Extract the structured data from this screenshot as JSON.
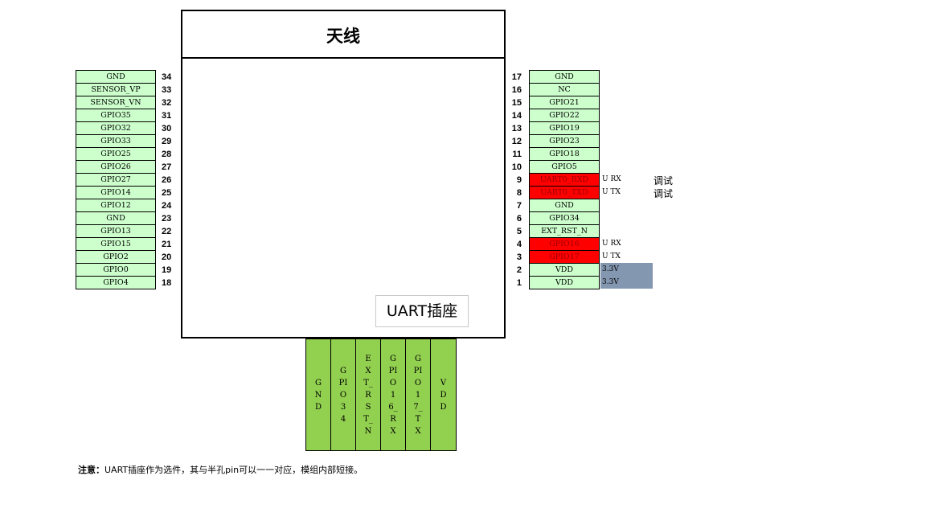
{
  "module": {
    "antenna_label": "天线",
    "uart_label": "UART插座"
  },
  "left_pins": [
    {
      "num": "34",
      "name": "GND"
    },
    {
      "num": "33",
      "name": "SENSOR_VP"
    },
    {
      "num": "32",
      "name": "SENSOR_VN"
    },
    {
      "num": "31",
      "name": "GPIO35"
    },
    {
      "num": "30",
      "name": "GPIO32"
    },
    {
      "num": "29",
      "name": "GPIO33"
    },
    {
      "num": "28",
      "name": "GPIO25"
    },
    {
      "num": "27",
      "name": "GPIO26"
    },
    {
      "num": "26",
      "name": "GPIO27"
    },
    {
      "num": "25",
      "name": "GPIO14"
    },
    {
      "num": "24",
      "name": "GPIO12"
    },
    {
      "num": "23",
      "name": "GND"
    },
    {
      "num": "22",
      "name": "GPIO13"
    },
    {
      "num": "21",
      "name": "GPIO15"
    },
    {
      "num": "20",
      "name": "GPIO2"
    },
    {
      "num": "19",
      "name": "GPIO0"
    },
    {
      "num": "18",
      "name": "GPIO4"
    }
  ],
  "right_pins": [
    {
      "num": "17",
      "name": "GND",
      "note": "",
      "highlight": false
    },
    {
      "num": "16",
      "name": "NC",
      "note": "",
      "highlight": false
    },
    {
      "num": "15",
      "name": "GPIO21",
      "note": "",
      "highlight": false
    },
    {
      "num": "14",
      "name": "GPIO22",
      "note": "",
      "highlight": false
    },
    {
      "num": "13",
      "name": "GPIO19",
      "note": "",
      "highlight": false
    },
    {
      "num": "12",
      "name": "GPIO23",
      "note": "",
      "highlight": false
    },
    {
      "num": "11",
      "name": "GPIO18",
      "note": "",
      "highlight": false
    },
    {
      "num": "10",
      "name": "GPIO5",
      "note": "",
      "highlight": false
    },
    {
      "num": "9",
      "name": "UART0_RXD",
      "note": "U RX",
      "highlight": true
    },
    {
      "num": "8",
      "name": "UART0_TXD",
      "note": "U TX",
      "highlight": true
    },
    {
      "num": "7",
      "name": "GND",
      "note": "",
      "highlight": false
    },
    {
      "num": "6",
      "name": "GPIO34",
      "note": "",
      "highlight": false
    },
    {
      "num": "5",
      "name": "EXT_RST_N",
      "note": "",
      "highlight": false
    },
    {
      "num": "4",
      "name": "GPIO16",
      "note": "U RX",
      "highlight": true
    },
    {
      "num": "3",
      "name": "GPIO17",
      "note": "U TX",
      "highlight": true
    },
    {
      "num": "2",
      "name": "VDD",
      "note": "3.3V",
      "highlight": false
    },
    {
      "num": "1",
      "name": "VDD",
      "note": "3.3V",
      "highlight": false
    }
  ],
  "debug_labels": [
    "调试",
    "调试"
  ],
  "uart_connector": [
    "GND",
    "GPIO34",
    "EXT_RST_N",
    "GPIO16_RX",
    "GPIO17_TX",
    "VDD"
  ],
  "footnote": {
    "label": "注意：",
    "text": "UART插座作为选件，其与半孔pin可以一一对应，模组内部短接。"
  },
  "colors": {
    "pin_fill": "#ccffcc",
    "highlight": "#ff0000",
    "connector": "#92d050",
    "vdd_note": "#8497b0"
  }
}
